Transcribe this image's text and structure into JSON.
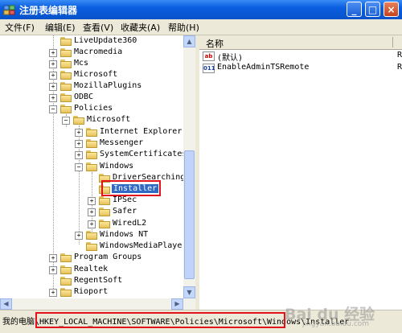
{
  "window": {
    "title": "注册表编辑器",
    "minimize_label": "_",
    "maximize_label": "□",
    "close_label": "×"
  },
  "menu": [
    {
      "label": "文件(F)"
    },
    {
      "label": "编辑(E)"
    },
    {
      "label": "查看(V)"
    },
    {
      "label": "收藏夹(A)"
    },
    {
      "label": "帮助(H)"
    }
  ],
  "tree": {
    "nodes": [
      {
        "label": "LiveUpdate360",
        "expander": ""
      },
      {
        "label": "Macromedia",
        "expander": "+"
      },
      {
        "label": "Mcs",
        "expander": "+"
      },
      {
        "label": "Microsoft",
        "expander": "+"
      },
      {
        "label": "MozillaPlugins",
        "expander": "+"
      },
      {
        "label": "ODBC",
        "expander": "+"
      },
      {
        "label": "Policies",
        "expander": "−"
      },
      {
        "label": "Microsoft",
        "expander": "−"
      },
      {
        "label": "Internet Explorer",
        "expander": "+"
      },
      {
        "label": "Messenger",
        "expander": "+"
      },
      {
        "label": "SystemCertificates",
        "expander": "+"
      },
      {
        "label": "Windows",
        "expander": "−"
      },
      {
        "label": "DriverSearching",
        "expander": ""
      },
      {
        "label": "Installer",
        "expander": "",
        "selected": true
      },
      {
        "label": "IPSec",
        "expander": "+"
      },
      {
        "label": "Safer",
        "expander": "+"
      },
      {
        "label": "WiredL2",
        "expander": "+"
      },
      {
        "label": "Windows NT",
        "expander": "+"
      },
      {
        "label": "WindowsMediaPlayer",
        "expander": ""
      },
      {
        "label": "Program Groups",
        "expander": "+"
      },
      {
        "label": "Realtek",
        "expander": "+"
      },
      {
        "label": "RegentSoft",
        "expander": ""
      },
      {
        "label": "Rioport",
        "expander": "+"
      }
    ]
  },
  "list": {
    "column_name": "名称",
    "rows": [
      {
        "name": "(默认)",
        "icon": "ab",
        "trunc": "R"
      },
      {
        "name": "EnableAdminTSRemote",
        "icon": "011",
        "trunc": "R"
      }
    ]
  },
  "status": {
    "path": "我的电脑\\HKEY_LOCAL_MACHINE\\SOFTWARE\\Policies\\Microsoft\\Windows\\Installer"
  },
  "watermark": {
    "main": "Bai du 经验",
    "sub": "jingyan.baidu.com"
  }
}
